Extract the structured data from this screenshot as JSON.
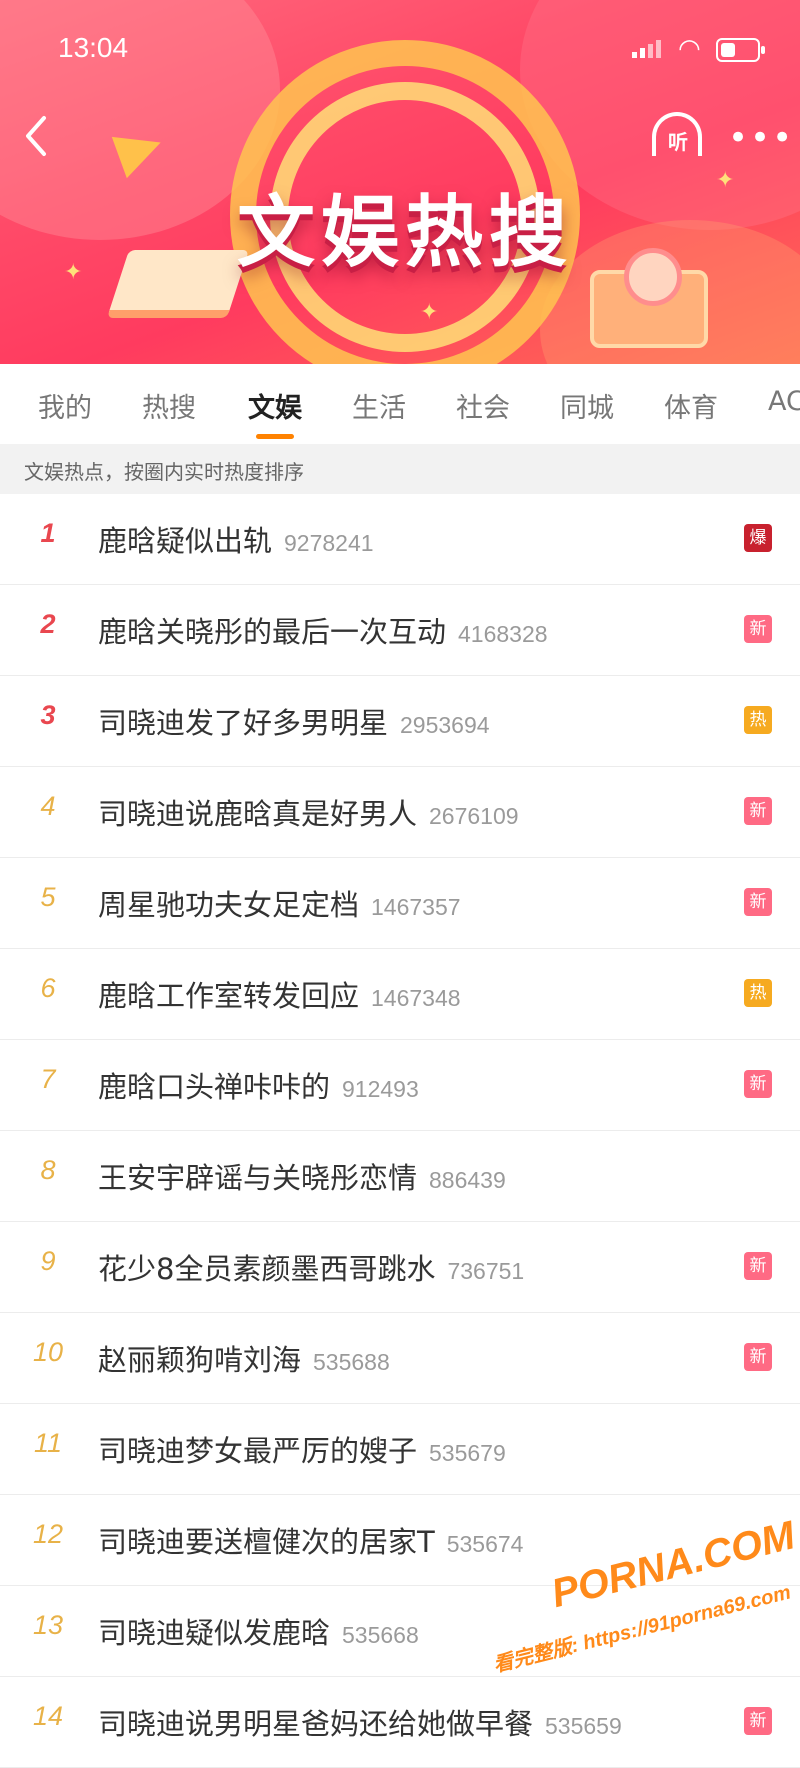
{
  "status_bar": {
    "time": "13:04"
  },
  "header": {
    "title": "文娱热搜",
    "listen_label": "听",
    "more_label": "•••"
  },
  "tabs": [
    {
      "label": "我的",
      "active": false
    },
    {
      "label": "热搜",
      "active": false
    },
    {
      "label": "文娱",
      "active": true
    },
    {
      "label": "生活",
      "active": false
    },
    {
      "label": "社会",
      "active": false
    },
    {
      "label": "同城",
      "active": false
    },
    {
      "label": "体育",
      "active": false
    },
    {
      "label": "AC",
      "active": false
    }
  ],
  "info_bar": {
    "text": "文娱热点，按圈内实时热度排序"
  },
  "list": [
    {
      "rank": "1",
      "title": "鹿晗疑似出轨",
      "heat": "9278241",
      "badge": "爆",
      "badge_type": "boom"
    },
    {
      "rank": "2",
      "title": "鹿晗关晓彤的最后一次互动",
      "heat": "4168328",
      "badge": "新",
      "badge_type": "new"
    },
    {
      "rank": "3",
      "title": "司晓迪发了好多男明星",
      "heat": "2953694",
      "badge": "热",
      "badge_type": "hot"
    },
    {
      "rank": "4",
      "title": "司晓迪说鹿晗真是好男人",
      "heat": "2676109",
      "badge": "新",
      "badge_type": "new"
    },
    {
      "rank": "5",
      "title": "周星驰功夫女足定档",
      "heat": "1467357",
      "badge": "新",
      "badge_type": "new"
    },
    {
      "rank": "6",
      "title": "鹿晗工作室转发回应",
      "heat": "1467348",
      "badge": "热",
      "badge_type": "hot"
    },
    {
      "rank": "7",
      "title": "鹿晗口头禅咔咔的",
      "heat": "912493",
      "badge": "新",
      "badge_type": "new"
    },
    {
      "rank": "8",
      "title": "王安宇辟谣与关晓彤恋情",
      "heat": "886439",
      "badge": "",
      "badge_type": ""
    },
    {
      "rank": "9",
      "title": "花少8全员素颜墨西哥跳水",
      "heat": "736751",
      "badge": "新",
      "badge_type": "new"
    },
    {
      "rank": "10",
      "title": "赵丽颖狗啃刘海",
      "heat": "535688",
      "badge": "新",
      "badge_type": "new"
    },
    {
      "rank": "11",
      "title": "司晓迪梦女最严厉的嫂子",
      "heat": "535679",
      "badge": "",
      "badge_type": ""
    },
    {
      "rank": "12",
      "title": "司晓迪要送檀健次的居家T",
      "heat": "535674",
      "badge": "",
      "badge_type": ""
    },
    {
      "rank": "13",
      "title": "司晓迪疑似发鹿晗",
      "heat": "535668",
      "badge": "",
      "badge_type": ""
    },
    {
      "rank": "14",
      "title": "司晓迪说男明星爸妈还给她做早餐",
      "heat": "535659",
      "badge": "新",
      "badge_type": "new"
    }
  ],
  "watermark": {
    "brand": "PORNA.COM",
    "url_line": "看完整版: https://91porna69.com"
  },
  "colors": {
    "banner": "#ff4a68",
    "active_tab_underline": "#ff8200",
    "rank_top": "#e9474f",
    "rank_other": "#e8b248",
    "badge_boom": "#c8212e",
    "badge_new": "#ff6a84",
    "badge_hot": "#f6aa20"
  }
}
